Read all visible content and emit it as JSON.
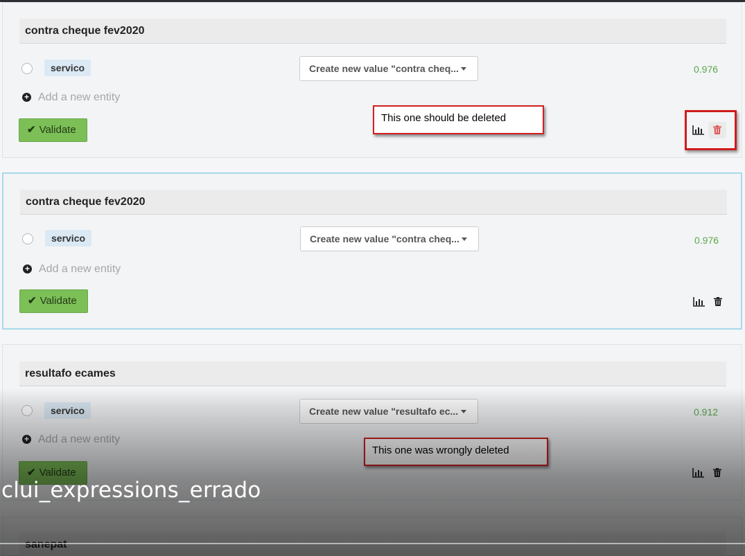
{
  "cards": [
    {
      "title": "contra cheque fev2020",
      "entity": "servico",
      "value_select": "Create new value \"contra cheq...",
      "score": "0.976",
      "add_entity": "Add a new entity",
      "validate": "Validate"
    },
    {
      "title": "contra cheque fev2020",
      "entity": "servico",
      "value_select": "Create new value \"contra cheq...",
      "score": "0.976",
      "add_entity": "Add a new entity",
      "validate": "Validate"
    },
    {
      "title": "resultafo ecames",
      "entity": "servico",
      "value_select": "Create new value \"resultafo ec...",
      "score": "0.912",
      "add_entity": "Add a new entity",
      "validate": "Validate"
    },
    {
      "title": "sanepat"
    }
  ],
  "annotations": {
    "should_delete": "This one should be deleted",
    "wrongly_deleted": "This one was wrongly deleted"
  },
  "video": {
    "caption": "clui_expressions_errado"
  },
  "colors": {
    "validate_green": "#7cbf57",
    "score_green": "#5aa84a",
    "chip_blue": "#dbe9f4",
    "callout_red": "#d02020",
    "trash_red": "#e05a5a"
  },
  "icons": [
    "check-icon",
    "plus-circle-icon",
    "bar-chart-icon",
    "trash-icon"
  ]
}
